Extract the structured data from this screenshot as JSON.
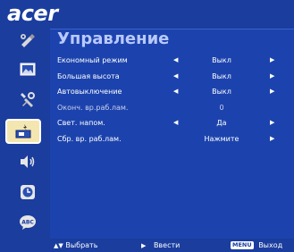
{
  "brand": {
    "logo_text": "acer"
  },
  "tabs": [
    {
      "name": "color-tab",
      "icon": "color-tools-icon",
      "active": false
    },
    {
      "name": "image-tab",
      "icon": "image-icon",
      "active": false
    },
    {
      "name": "settings-tab",
      "icon": "settings-icon",
      "active": false
    },
    {
      "name": "management-tab",
      "icon": "lamp-management-icon",
      "active": true
    },
    {
      "name": "audio-tab",
      "icon": "speaker-icon",
      "active": false
    },
    {
      "name": "timer-tab",
      "icon": "timer-icon",
      "active": false
    },
    {
      "name": "language-tab",
      "icon": "language-abc-icon",
      "active": false
    }
  ],
  "panel": {
    "title": "Управление",
    "rows": [
      {
        "label": "Економный режим",
        "value": "Выкл",
        "left_arrow": true,
        "right_arrow": true,
        "dim": false
      },
      {
        "label": "Большая высота",
        "value": "Выкл",
        "left_arrow": true,
        "right_arrow": true,
        "dim": false
      },
      {
        "label": "Автовыключение",
        "value": "Выкл",
        "left_arrow": true,
        "right_arrow": true,
        "dim": false
      },
      {
        "label": "Оконч. вр.раб.лам.",
        "value": "0",
        "left_arrow": false,
        "right_arrow": false,
        "dim": true
      },
      {
        "label": "Свет. напом.",
        "value": "Да",
        "left_arrow": true,
        "right_arrow": true,
        "dim": false
      },
      {
        "label": "Сбр. вр. раб.лам.",
        "value": "Нажмите",
        "left_arrow": false,
        "right_arrow": true,
        "dim": false
      }
    ]
  },
  "bottom_bar": {
    "select_icon": "▲▼",
    "select_label": "Выбрать",
    "enter_icon": "▶",
    "enter_label": "Ввести",
    "menu_key": "MENU",
    "exit_label": "Выход"
  },
  "colors": {
    "background": "#1a3d9e",
    "panel": "#1c43ad",
    "title": "#b9c9ff",
    "active_tab": "#f3e6b0"
  }
}
